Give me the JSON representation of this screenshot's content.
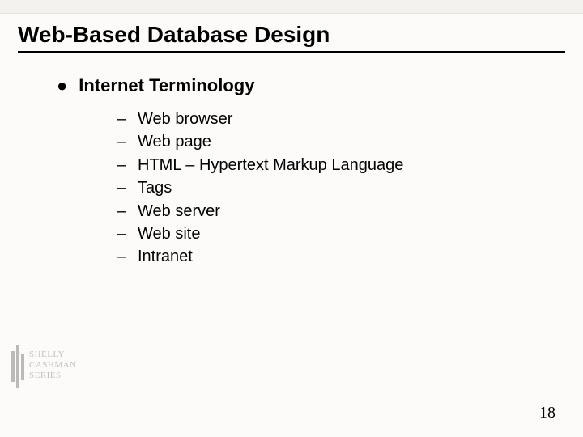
{
  "title": "Web-Based Database Design",
  "heading": {
    "bullet": "●",
    "text": "Internet Terminology"
  },
  "items": [
    "Web browser",
    "Web page",
    "HTML – Hypertext Markup Language",
    "Tags",
    "Web server",
    "Web site",
    "Intranet"
  ],
  "dash": "–",
  "page_number": "18",
  "brand": {
    "line1": "SHELLY",
    "line2": "CASHMAN",
    "line3": "SERIES"
  }
}
